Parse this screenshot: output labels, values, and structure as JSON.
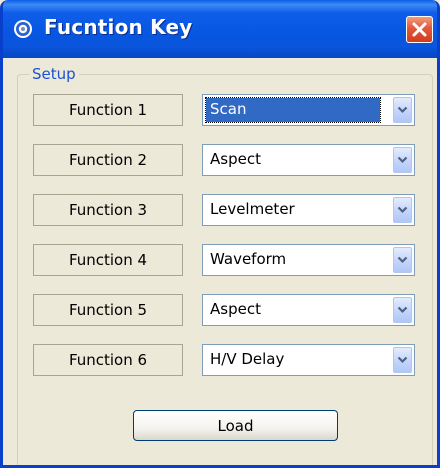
{
  "window": {
    "title": "Fucntion Key",
    "icon": "gear-icon",
    "close_icon": "close-icon"
  },
  "setup": {
    "group_label": "Setup",
    "rows": [
      {
        "label": "Function 1",
        "value": "Scan",
        "selected": true
      },
      {
        "label": "Function 2",
        "value": "Aspect"
      },
      {
        "label": "Function 3",
        "value": "Levelmeter"
      },
      {
        "label": "Function 4",
        "value": "Waveform"
      },
      {
        "label": "Function 5",
        "value": "Aspect"
      },
      {
        "label": "Function 6",
        "value": "H/V Delay"
      }
    ],
    "load_label": "Load"
  },
  "colors": {
    "titlebar": "#0757e2",
    "close_button": "#e2583a",
    "group_label": "#1b52d1",
    "selection": "#316ac5"
  }
}
